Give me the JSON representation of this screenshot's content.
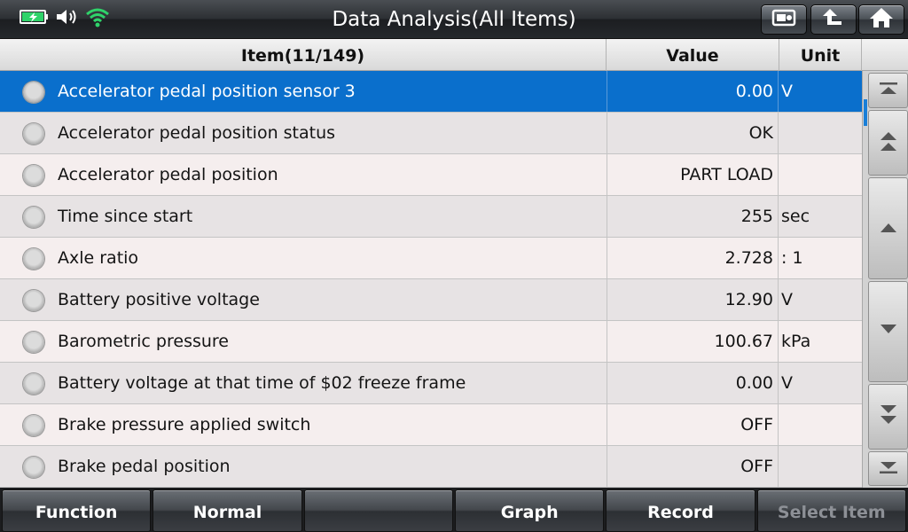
{
  "title": "Data Analysis(All Items)",
  "status": {
    "battery": "battery-charging-icon",
    "volume": "volume-icon",
    "wifi": "wifi-icon",
    "accent": "#2fd36a"
  },
  "toolbar": {
    "buttons": [
      "screenshot-icon",
      "back-up-icon",
      "home-icon"
    ]
  },
  "table": {
    "header": {
      "item": "Item(11/149)",
      "value": "Value",
      "unit": "Unit"
    },
    "rows": [
      {
        "name": "Accelerator pedal position sensor 3",
        "value": "0.00",
        "unit": "V",
        "selected": true
      },
      {
        "name": "Accelerator pedal position status",
        "value": "OK",
        "unit": ""
      },
      {
        "name": "Accelerator pedal position",
        "value": "PART LOAD",
        "unit": ""
      },
      {
        "name": "Time since start",
        "value": "255",
        "unit": "sec"
      },
      {
        "name": "Axle ratio",
        "value": "2.728",
        "unit": ": 1"
      },
      {
        "name": "Battery positive voltage",
        "value": "12.90",
        "unit": "V"
      },
      {
        "name": "Barometric pressure",
        "value": "100.67",
        "unit": "kPa"
      },
      {
        "name": "Battery voltage at that time of $02 freeze frame",
        "value": "0.00",
        "unit": "V"
      },
      {
        "name": "Brake pressure applied switch",
        "value": "OFF",
        "unit": ""
      },
      {
        "name": "Brake pedal position",
        "value": "OFF",
        "unit": ""
      }
    ],
    "selected_color": "#0a6fcc"
  },
  "bottom": {
    "buttons": [
      "Function",
      "Normal",
      "",
      "Graph",
      "Record",
      "Select Item"
    ]
  }
}
